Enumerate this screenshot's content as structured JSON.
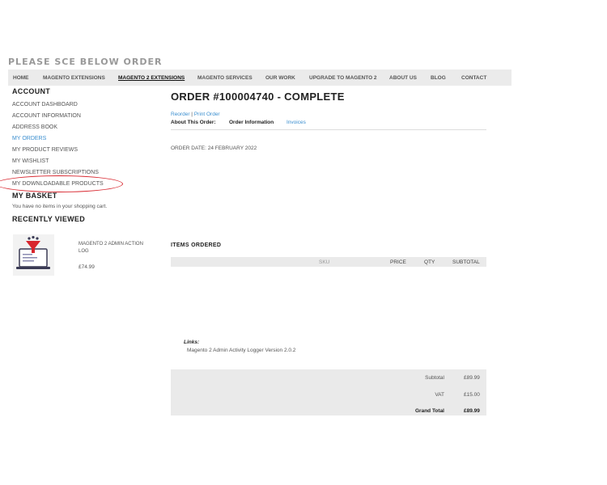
{
  "header": {
    "top_text": "PLEASE SCE BELOW ORDER"
  },
  "nav": {
    "items": [
      {
        "label": "HOME"
      },
      {
        "label": "MAGENTO EXTENSIONS"
      },
      {
        "label": "MAGENTO 2 EXTENSIONS"
      },
      {
        "label": "MAGENTO SERVICES"
      },
      {
        "label": "OUR WORK"
      },
      {
        "label": "UPGRADE TO MAGENTO 2"
      },
      {
        "label": "ABOUT US"
      },
      {
        "label": "BLOG"
      },
      {
        "label": "CONTACT"
      }
    ]
  },
  "sidebar": {
    "account_title": "ACCOUNT",
    "links": [
      {
        "label": "ACCOUNT DASHBOARD"
      },
      {
        "label": "ACCOUNT INFORMATION"
      },
      {
        "label": "ADDRESS BOOK"
      },
      {
        "label": "MY ORDERS"
      },
      {
        "label": "MY PRODUCT REVIEWS"
      },
      {
        "label": "MY WISHLIST"
      },
      {
        "label": "NEWSLETTER SUBSCRIPTIONS"
      },
      {
        "label": "MY DOWNLOADABLE PRODUCTS"
      }
    ],
    "basket_title": "MY BASKET",
    "basket_text": "You have no items in your shopping cart.",
    "recent_title": "RECENTLY VIEWED",
    "recent_product": {
      "name_line1": "MAGENTO 2 ADMIN ACTION",
      "name_line2": "LOG",
      "price": "£74.99"
    }
  },
  "order": {
    "title": "ORDER #100004740 - COMPLETE",
    "reorder": "Reorder",
    "separator": "|",
    "print": "Print Order",
    "about_label": "About This Order:",
    "tab_info": "Order Information",
    "tab_invoices": "Invoices",
    "date": "ORDER DATE: 24 FEBRUARY 2022",
    "items_title": "ITEMS ORDERED",
    "columns": {
      "sku": "SKU",
      "price": "PRICE",
      "qty": "QTY",
      "subtotal": "SUBTOTAL"
    },
    "links_label": "Links:",
    "link_item": "Magento 2 Admin Activity Logger Version 2.0.2",
    "totals": [
      {
        "label": "Subtotal",
        "value": "£89.99"
      },
      {
        "label": "VAT",
        "value": "£15.00"
      },
      {
        "label": "Grand Total",
        "value": "£89.99"
      }
    ]
  },
  "colors": {
    "link": "#3a8ecf",
    "annotation": "#d8262e"
  }
}
